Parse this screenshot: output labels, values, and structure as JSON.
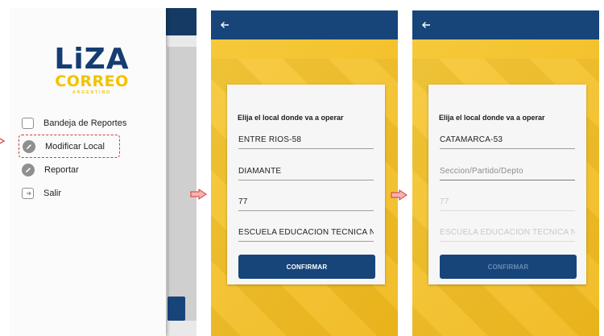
{
  "drawer": {
    "logo": {
      "brand": "LiZA",
      "sub": "CORREO",
      "tag": "ARGENTINO"
    },
    "items": [
      {
        "label": "Bandeja de Reportes",
        "icon": "inbox-icon"
      },
      {
        "label": "Modificar Local",
        "icon": "edit-pencil-icon",
        "selected": true
      },
      {
        "label": "Reportar",
        "icon": "edit-pencil-icon"
      },
      {
        "label": "Salir",
        "icon": "exit-icon"
      }
    ]
  },
  "screen2": {
    "card_title": "Elija el local donde va a operar",
    "fields": [
      {
        "value": "ENTRE RIOS-58",
        "state": "filled"
      },
      {
        "value": "DIAMANTE",
        "state": "filled"
      },
      {
        "value": "77",
        "state": "filled"
      },
      {
        "value": "ESCUELA EDUCACION TECNICA N",
        "state": "filled"
      }
    ],
    "confirm_label": "CONFIRMAR"
  },
  "screen3": {
    "card_title": "Elija el local donde va a operar",
    "fields": [
      {
        "value": "CATAMARCA-53",
        "state": "filled"
      },
      {
        "value": "Seccion/Partido/Depto",
        "state": "placeholder"
      },
      {
        "value": "77",
        "state": "disabled"
      },
      {
        "value": "ESCUELA EDUCACION TECNICA N",
        "state": "disabled"
      }
    ],
    "confirm_label": "CONFIRMAR"
  },
  "colors": {
    "primary": "#17457a",
    "accent": "#f2c200",
    "highlight": "#d43a3a"
  }
}
